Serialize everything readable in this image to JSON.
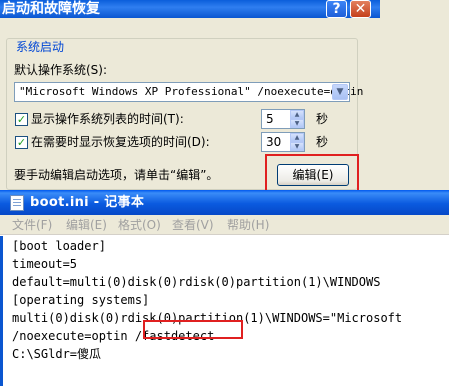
{
  "dialog": {
    "title": "启动和故障恢复",
    "help_glyph": "?",
    "close_glyph": "✕",
    "group_label": "系统启动",
    "default_os_label": "默认操作系统(S):",
    "default_os_value": "\"Microsoft Windows XP Professional\" /noexecute=optin",
    "show_list_label": "显示操作系统列表的时间(T):",
    "show_list_checked": true,
    "show_list_value": "5",
    "show_recovery_label": "在需要时显示恢复选项的时间(D):",
    "show_recovery_checked": true,
    "show_recovery_value": "30",
    "seconds_unit": "秒",
    "edit_hint": "要手动编辑启动选项，请单击“编辑”。",
    "edit_button_label": "编辑(E)"
  },
  "notepad": {
    "title": "boot.ini - 记事本",
    "menu": [
      "文件(F)",
      "编辑(E)",
      "格式(O)",
      "查看(V)",
      "帮助(H)"
    ],
    "lines": [
      "[boot loader]",
      "timeout=5",
      "default=multi(0)disk(0)rdisk(0)partition(1)\\WINDOWS",
      "[operating systems]",
      "multi(0)disk(0)rdisk(0)partition(1)\\WINDOWS=\"Microsoft",
      "/noexecute=optin /fastdetect",
      "C:\\SGldr=傻瓜"
    ]
  },
  "colors": {
    "xp_titlebar_blue": "#0A5ADF",
    "highlight_red": "#E02020",
    "group_label_blue": "#0046D5"
  }
}
